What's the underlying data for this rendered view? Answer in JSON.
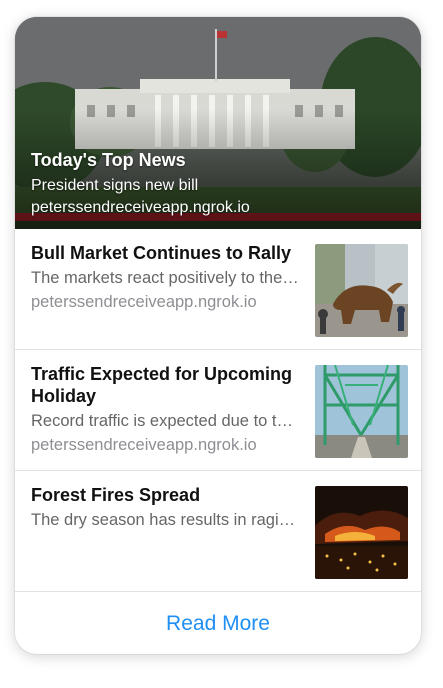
{
  "hero": {
    "title": "Today's Top News",
    "subtitle": "President signs new bill",
    "source": "peterssendreceiveapp.ngrok.io"
  },
  "articles": [
    {
      "title": "Bull Market Continues to Rally",
      "summary": "The markets react positively to the news",
      "source": "peterssendreceiveapp.ngrok.io"
    },
    {
      "title": "Traffic Expected for Upcoming Holiday",
      "summary": "Record traffic is expected due to the holiday",
      "source": "peterssendreceiveapp.ngrok.io"
    },
    {
      "title": "Forest Fires Spread",
      "summary": "The dry season has results in raging fires",
      "source": ""
    }
  ],
  "footer": {
    "read_more_label": "Read More"
  },
  "colors": {
    "link": "#1f8ff3",
    "separator": "#e2e2e4"
  }
}
